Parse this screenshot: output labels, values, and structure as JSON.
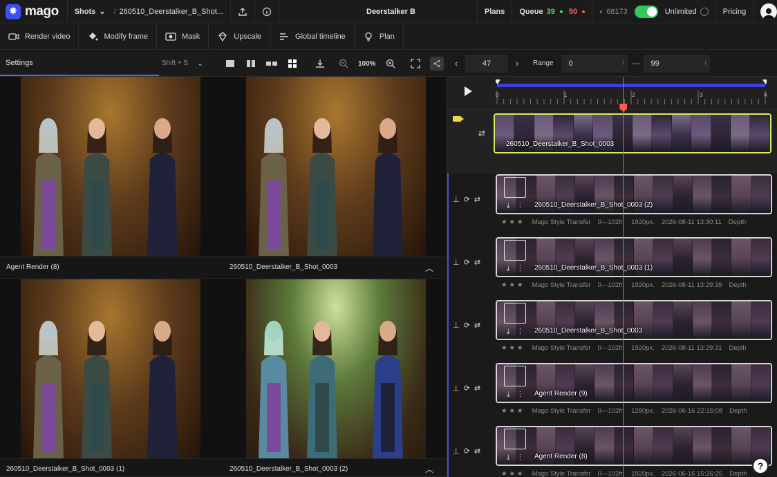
{
  "app": {
    "logo_text": "mago",
    "project_title": "Deerstalker B",
    "breadcrumb_root": "Shots",
    "breadcrumb_shot": "260510_Deerstalker_B_Shot..."
  },
  "topbar": {
    "plans_label": "Plans",
    "queue_label": "Queue",
    "queue_green": "39",
    "queue_red": "50",
    "credits": "68173",
    "unlimited_label": "Unlimited",
    "pricing_label": "Pricing",
    "colors": {
      "accent": "#5865f2",
      "toggle_on": "#34c759",
      "queue_green": "#4cd964",
      "queue_red": "#ff5a5a"
    }
  },
  "toolbar": {
    "tools": [
      {
        "label": "Render video",
        "icon": "video-camera-icon"
      },
      {
        "label": "Modify frame",
        "icon": "paint-bucket-icon"
      },
      {
        "label": "Mask",
        "icon": "image-mask-icon"
      },
      {
        "label": "Upscale",
        "icon": "upscale-diamond-icon"
      },
      {
        "label": "Global timeline",
        "icon": "timeline-icon"
      },
      {
        "label": "Plan",
        "icon": "lightbulb-icon"
      }
    ]
  },
  "left": {
    "settings_label": "Settings",
    "shortcut": "Shift + S",
    "zoom": "100%",
    "cells": [
      {
        "caption": "Agent Render (8)"
      },
      {
        "caption": "260510_Deerstalker_B_Shot_0003"
      },
      {
        "caption": "260510_Deerstalker_B_Shot_0003 (1)"
      },
      {
        "caption": "260510_Deerstalker_B_Shot_0003 (2)"
      }
    ]
  },
  "timeline": {
    "current_frame": "47",
    "range_label": "Range",
    "range_start": "0",
    "range_end": "99",
    "frame_unit": "f",
    "ruler_ticks": [
      "0",
      "1",
      "2",
      "3",
      "4"
    ],
    "playhead_fraction": 0.47,
    "tracks": [
      {
        "name": "260510_Deerstalker_B_Shot_0003",
        "selected": true
      },
      {
        "name": "260510_Deerstalker_B_Shot_0003 (2)",
        "model": "Mago Style Transfer",
        "frames": "0—102fr.",
        "res": "1920px.",
        "date": "2026-08-11 13:30:11",
        "mode": "Depth"
      },
      {
        "name": "260510_Deerstalker_B_Shot_0003 (1)",
        "model": "Mago Style Transfer",
        "frames": "0—102fr.",
        "res": "1920px.",
        "date": "2026-08-11 13:29:39",
        "mode": "Depth"
      },
      {
        "name": "260510_Deerstalker_B_Shot_0003",
        "model": "Mago Style Transfer",
        "frames": "0—102fr.",
        "res": "1920px.",
        "date": "2026-08-11 13:29:31",
        "mode": "Depth"
      },
      {
        "name": "Agent Render (9)",
        "model": "Mago Style Transfer",
        "frames": "0—102fr.",
        "res": "1280px.",
        "date": "2026-06-16 22:15:08",
        "mode": "Depth"
      },
      {
        "name": "Agent Render (8)",
        "model": "Mago Style Transfer",
        "frames": "0—102fr.",
        "res": "1920px.",
        "date": "2026-06-16 15:26:25",
        "mode": "Depth"
      }
    ]
  }
}
